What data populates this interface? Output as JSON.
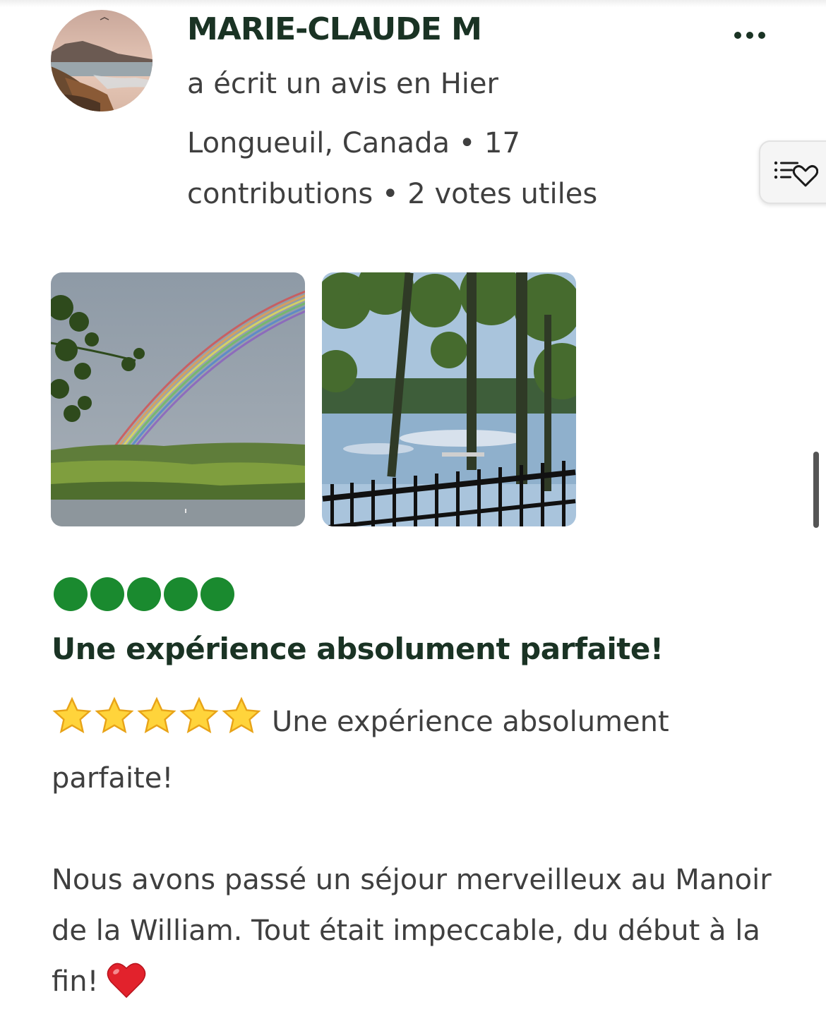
{
  "reviewer": {
    "name": "MARIE-CLAUDE M",
    "wrote_text": "a écrit un avis en Hier",
    "location_line": "Longueuil, Canada • 17",
    "contributions_line": "contributions • 2 votes utiles",
    "avatar_icon": "coastline-avatar"
  },
  "actions": {
    "more_icon": "more-horizontal-icon",
    "save_icon": "save-to-list-heart-icon"
  },
  "photos": [
    {
      "subject": "rainbow-over-lake"
    },
    {
      "subject": "lake-view-from-deck"
    }
  ],
  "rating": {
    "value": 5,
    "max": 5,
    "color": "#1a8a2f"
  },
  "review": {
    "title": "Une expérience absolument parfaite!",
    "star_emoji_count": 5,
    "intro": "Une expérience absolument parfaite!",
    "body": "Nous avons passé un séjour merveilleux au Manoir de la William. Tout était impeccable, du début à la fin!",
    "heart_emoji": "red-heart"
  },
  "colors": {
    "title_green": "#1a3324",
    "bubble_green": "#1a8a2f",
    "text_gray": "#3f3f3f"
  }
}
